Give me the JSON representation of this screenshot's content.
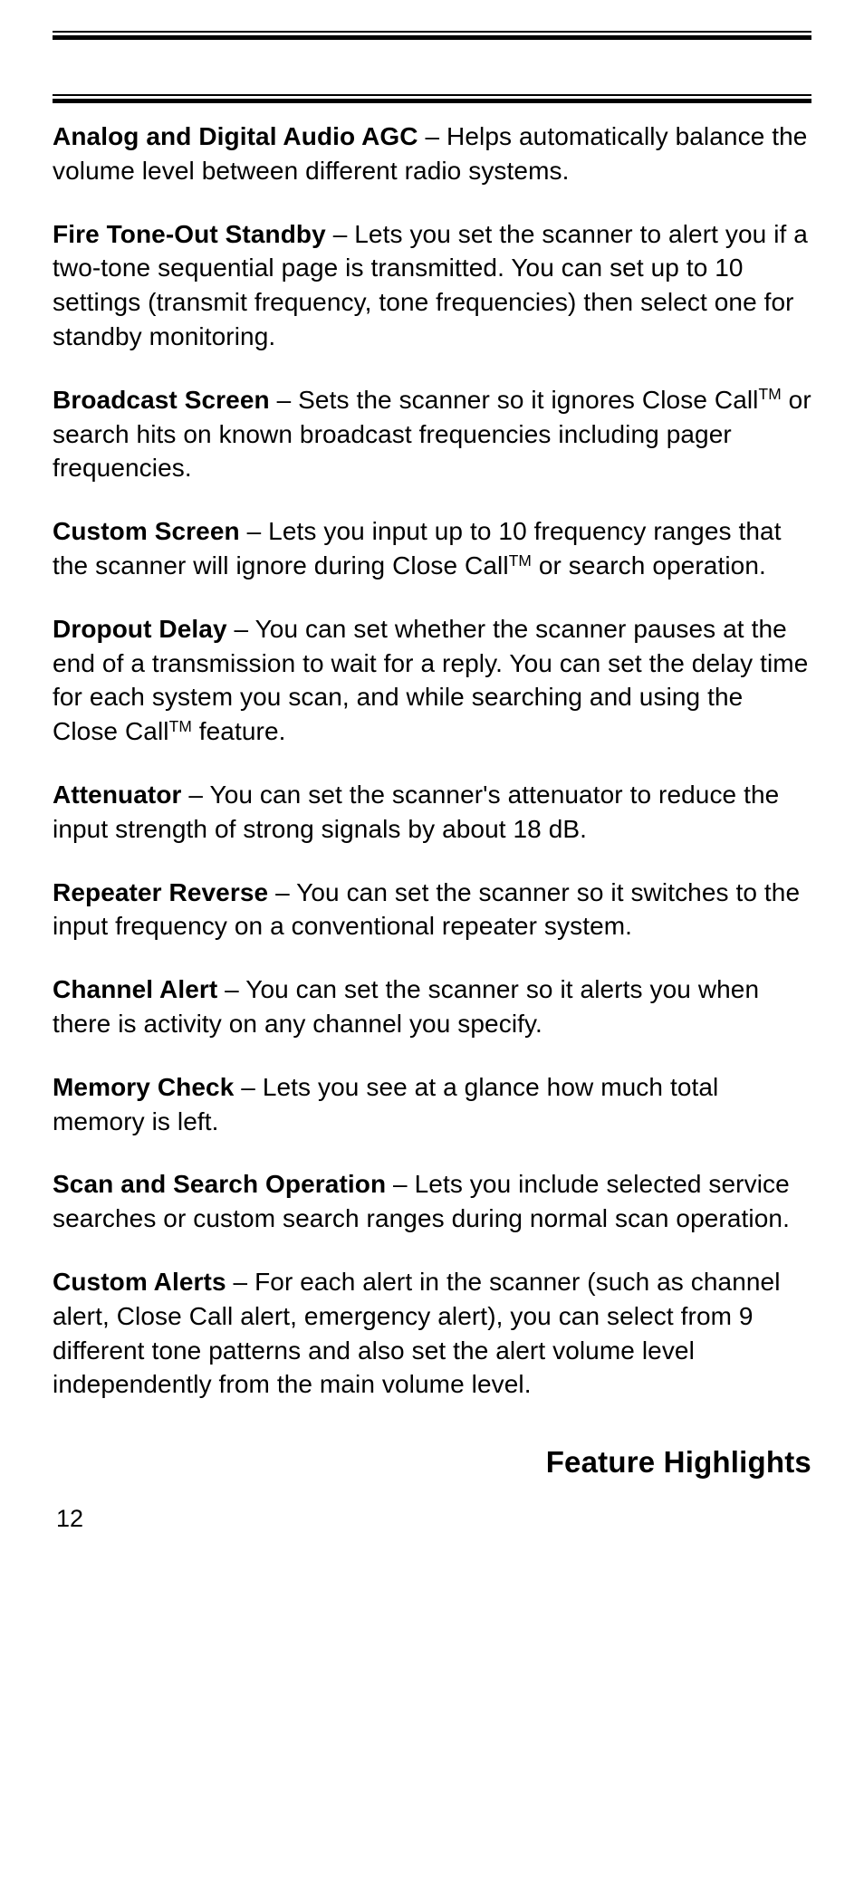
{
  "entries": [
    {
      "term": "Analog and Digital Audio AGC",
      "sep": " – ",
      "text": "Helps automatically balance the volume level between different radio systems."
    },
    {
      "term": "Fire Tone-Out Standby",
      "sep": " – ",
      "text": "Lets you set the scanner to alert you if a two-tone sequential page is transmitted. You can set up to 10 settings (transmit frequency, tone frequencies) then select one for standby monitoring."
    },
    {
      "term": "Broadcast Screen",
      "sep": " – ",
      "pre": "Sets the scanner so it ignores Close Call",
      "tm": "TM",
      "post": " or search hits on known broadcast frequencies including pager frequencies."
    },
    {
      "term": "Custom Screen",
      "sep": " – ",
      "pre": "Lets you input up to 10 frequency ranges that the scanner will ignore during Close Call",
      "tm": "TM",
      "post": " or search operation."
    },
    {
      "term": "Dropout Delay",
      "sep": " – ",
      "pre": "You can set whether the scanner pauses at the end of a transmission to wait for a reply. You can set the delay time for each system you scan, and while searching and using the Close Call",
      "tm": "TM",
      "post": " feature."
    },
    {
      "term": "Attenuator",
      "sep": " – ",
      "text": "You can set the scanner's attenuator to reduce the input strength of strong signals by about 18 dB."
    },
    {
      "term": "Repeater Reverse",
      "sep": " – ",
      "text": "You can set the scanner so it switches to the input frequency on a conventional repeater system."
    },
    {
      "term": "Channel Alert",
      "sep": " – ",
      "text": "You can set the scanner so it alerts you when there is activity on any channel you specify."
    },
    {
      "term": "Memory Check",
      "sep": " – ",
      "text": "Lets you see at a glance how much total memory is left."
    },
    {
      "term": "Scan and Search Operation",
      "sep": " – ",
      "text": "Lets you include selected service searches or custom search ranges during normal scan operation."
    },
    {
      "term": "Custom Alerts",
      "sep": " – ",
      "text": "For each alert in the scanner (such as channel alert, Close Call alert, emergency alert), you can select from 9 different tone patterns and also set the alert volume level independently from the main volume level."
    }
  ],
  "footer_title": "Feature Highlights",
  "page_number": "12"
}
